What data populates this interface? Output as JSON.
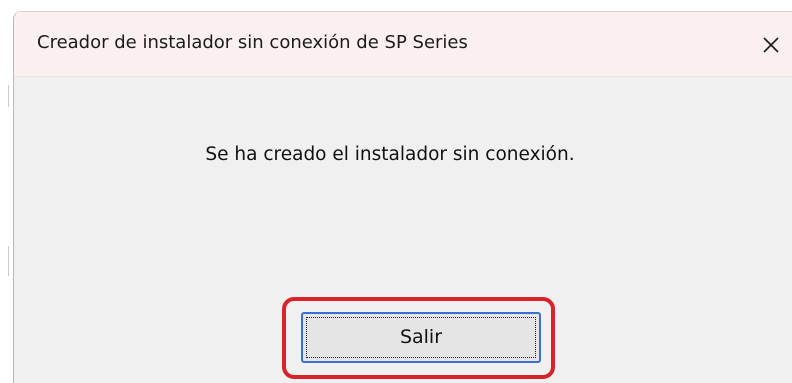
{
  "window": {
    "title": "Creador de instalador sin conexión de SP Series",
    "close_icon": "close-icon"
  },
  "dialog": {
    "message": "Se ha creado el instalador sin conexión.",
    "exit_button_label": "Salir"
  },
  "colors": {
    "titlebar_bg": "#fbf0f0",
    "body_bg": "#f0f0f0",
    "button_focus_border": "#3b6fd1",
    "highlight_ring": "#d8232a"
  }
}
